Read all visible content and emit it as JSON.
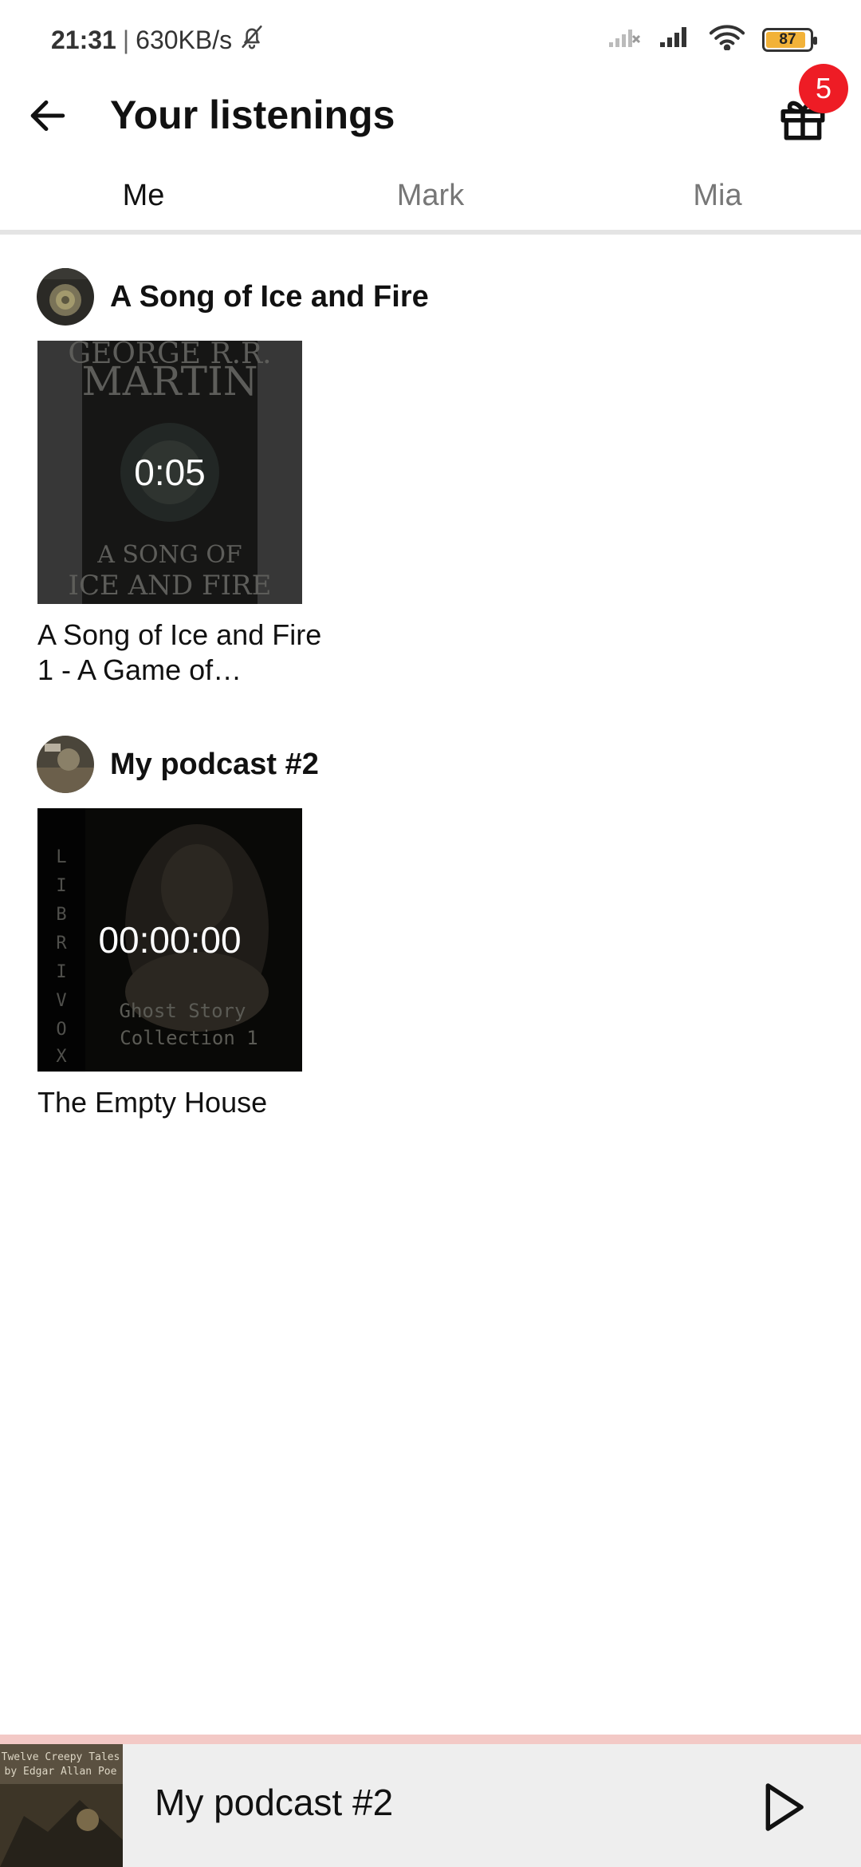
{
  "status_bar": {
    "time": "21:31",
    "separator": "|",
    "net_speed": "630KB/s",
    "battery": "87"
  },
  "header": {
    "title": "Your listenings",
    "gift_badge": "5"
  },
  "tabs": [
    {
      "label": "Me",
      "active": true
    },
    {
      "label": "Mark",
      "active": false
    },
    {
      "label": "Mia",
      "active": false
    }
  ],
  "sections": [
    {
      "title": "A Song of Ice and Fire",
      "episodes": [
        {
          "title": "A Song of Ice and Fire 1 - A Game of…",
          "progress": "0:05"
        }
      ]
    },
    {
      "title": "My podcast #2",
      "episodes": [
        {
          "title": "The Empty House",
          "progress": "00:00:00"
        }
      ]
    }
  ],
  "mini_player": {
    "title": "My podcast #2"
  },
  "colors": {
    "badge": "#ee1c25",
    "battery_fill": "#f2b239",
    "mini_player_bg": "#eeeeee"
  }
}
